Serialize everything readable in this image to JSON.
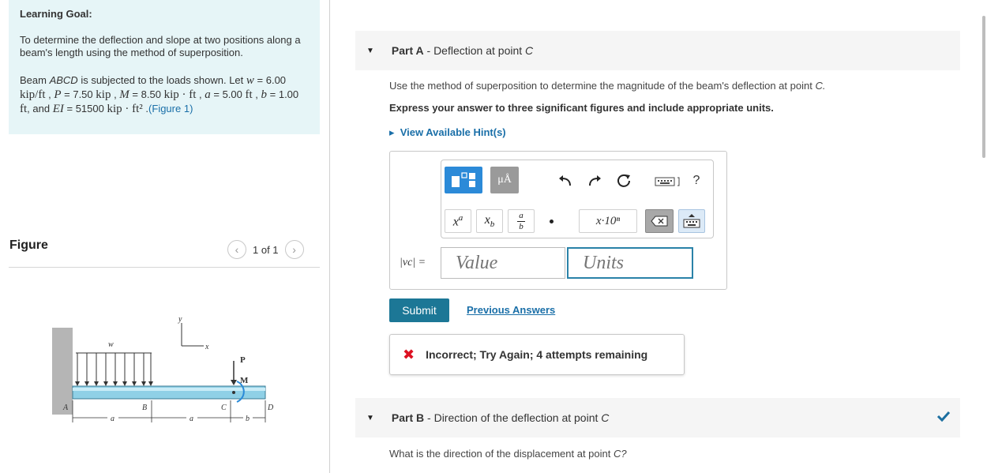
{
  "learning_goal": {
    "title": "Learning Goal:",
    "text": "To determine the deflection and slope at two positions along a beam's length using the method of superposition.",
    "problem_prefix": "Beam ",
    "beam_name": "ABCD",
    "problem_mid": " is subjected to the loads shown. Let ",
    "w_sym": "w",
    "w_val": "6.00",
    "w_unit": "kip/ft",
    "P_sym": "P",
    "P_val": "7.50",
    "P_unit": "kip",
    "M_sym": "M",
    "M_val": "8.50",
    "M_unit": "kip · ft",
    "a_sym": "a",
    "a_val": "5.00",
    "a_unit": "ft",
    "b_sym": "b",
    "b_val": "1.00",
    "b_unit": "ft",
    "and_text": ", and ",
    "EI_sym": "EI",
    "EI_val": "51500",
    "EI_unit": "kip · ft²",
    "figure_link": "(Figure 1)"
  },
  "figure": {
    "label": "Figure",
    "pager_text": "1 of 1",
    "labels": {
      "w": "w",
      "y": "y",
      "x": "x",
      "P": "P",
      "M": "M",
      "A": "A",
      "B": "B",
      "C": "C",
      "D": "D",
      "a1": "a",
      "a2": "a",
      "b": "b"
    }
  },
  "part_a": {
    "title_bold": "Part A",
    "title_rest": " - Deflection at point ",
    "title_point": "C",
    "question": "Use the method of superposition to determine the magnitude of the beam's deflection at point ",
    "question_point": "C.",
    "instruction": "Express your answer to three significant figures and include appropriate units.",
    "hint": "View Available Hint(s)",
    "answer_label": "|vc| =",
    "value_placeholder": "Value",
    "units_placeholder": "Units",
    "submit": "Submit",
    "previous_answers": "Previous Answers",
    "feedback": "Incorrect; Try Again; 4 attempts remaining",
    "toolbar": {
      "mu": "μÅ",
      "x10": "x·10ⁿ",
      "help": "?"
    }
  },
  "part_b": {
    "title_bold": "Part B",
    "title_rest": " - Direction of the deflection at point ",
    "title_point": "C",
    "question": "What is the direction of the displacement at point ",
    "question_point": "C?"
  },
  "colors": {
    "goal_bg": "#e6f5f7",
    "link": "#1a6fa8",
    "submit_bg": "#1c7796",
    "error": "#dd1122",
    "check": "#1c6fa0"
  }
}
